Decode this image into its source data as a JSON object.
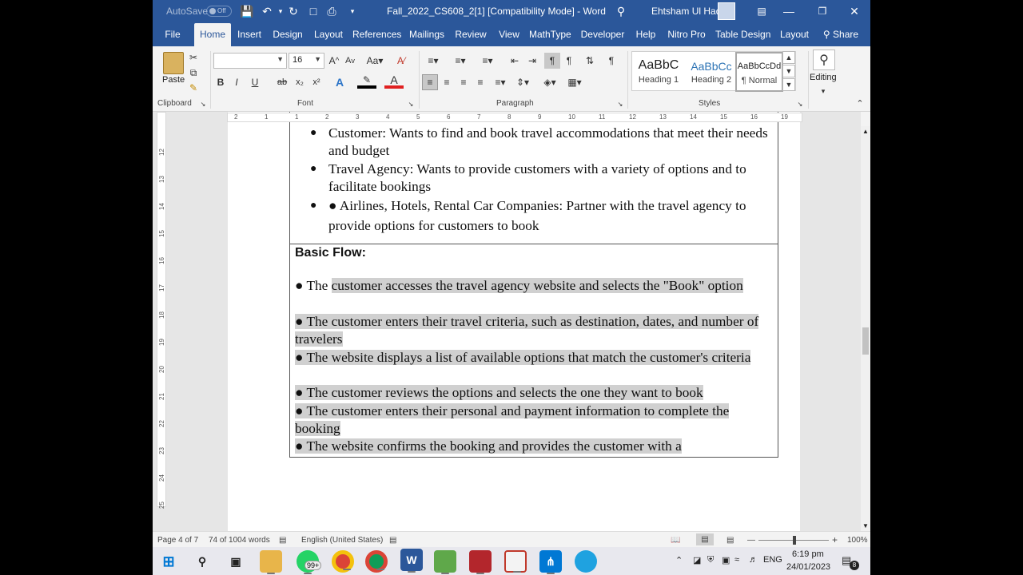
{
  "titlebar": {
    "autosave": "AutoSave",
    "autosave_state": "Off",
    "doc_title": "Fall_2022_CS608_2[1] [Compatibility Mode] - Word",
    "user": "Ehtsham Ul Haq"
  },
  "tabs": [
    "File",
    "Home",
    "Insert",
    "Design",
    "Layout",
    "References",
    "Mailings",
    "Review",
    "View",
    "MathType",
    "Developer",
    "Help",
    "Nitro Pro",
    "Table Design",
    "Layout"
  ],
  "share": "Share",
  "ribbon": {
    "paste": "Paste",
    "font_size": "16",
    "styles": [
      {
        "preview": "AaBbC",
        "name": "Heading 1"
      },
      {
        "preview": "AaBbCc",
        "name": "Heading 2"
      },
      {
        "preview": "AaBbCcDd",
        "name": "¶ Normal"
      }
    ],
    "editing": "Editing",
    "groups": {
      "clipboard": "Clipboard",
      "font": "Font",
      "paragraph": "Paragraph",
      "styles": "Styles"
    }
  },
  "ruler_h": [
    "2",
    "1",
    "1",
    "2",
    "3",
    "4",
    "5",
    "6",
    "7",
    "8",
    "9",
    "10",
    "11",
    "12",
    "13",
    "14",
    "15",
    "16",
    "19"
  ],
  "ruler_v": [
    "12",
    "13",
    "14",
    "15",
    "16",
    "17",
    "18",
    "19",
    "20",
    "21",
    "22",
    "23",
    "24",
    "25"
  ],
  "document": {
    "stakeholders": [
      {
        "bullet": "●",
        "text": "Customer: Wants to find and book travel accommodations that meet their needs and budget"
      },
      {
        "bullet": "●",
        "text": "Travel Agency: Wants to provide customers with a variety of options and to facilitate bookings"
      },
      {
        "bullet": "●",
        "text": "●  Airlines, Hotels, Rental Car Companies: Partner with the travel agency to provide options for customers to book"
      }
    ],
    "basic_flow_title": "Basic Flow:",
    "flow": [
      {
        "lead": "●  The ",
        "text": "customer accesses the travel agency website and selects the \"Book\" option"
      },
      {
        "lead": "●  ",
        "text": "The customer enters their travel criteria, such as destination, dates, and number of travelers"
      },
      {
        "lead": "●  ",
        "text": "The website displays a list of available options that match the customer's criteria"
      },
      {
        "lead": "●  ",
        "text": "The customer reviews the options and selects the one they want to book"
      },
      {
        "lead": "●  ",
        "text": "The customer enters their personal and payment information to complete the booking"
      },
      {
        "lead": "●  ",
        "text": "The website confirms the booking and provides the customer with a"
      }
    ]
  },
  "status": {
    "page": "Page 4 of 7",
    "words": "74 of 1004 words",
    "language": "English (United States)",
    "zoom": "100%"
  },
  "taskbar": {
    "badge": "99+",
    "lang": "ENG",
    "time": "6:19 pm",
    "date": "24/01/2023",
    "notif": "8"
  },
  "colors": {
    "word_blue": "#2b579a",
    "highlight": "#d0d0d0"
  }
}
